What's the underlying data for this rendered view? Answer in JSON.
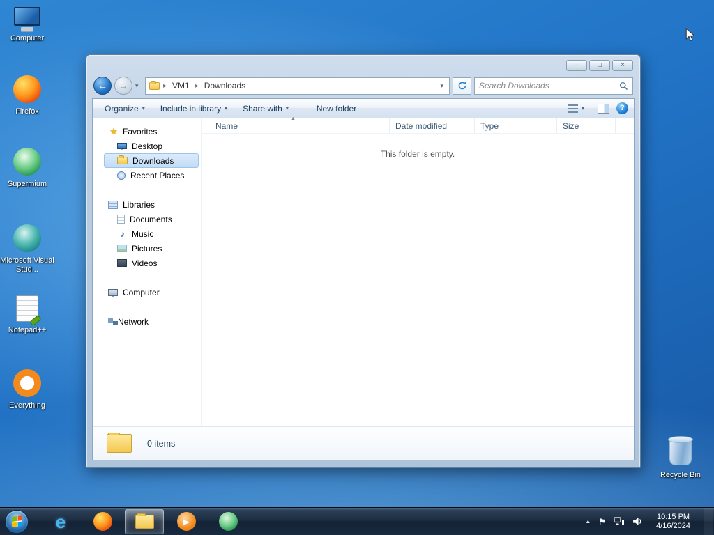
{
  "icons": {
    "back_arrow": "←",
    "forward_arrow": "→",
    "caret_down": "▾",
    "breadcrumb_sep": "▸",
    "sort_asc": "▲",
    "minimize": "–",
    "maximize": "□",
    "close": "×",
    "star": "★",
    "music_note": "♪",
    "help": "?",
    "tray_chevron": "▲",
    "tray_flag": "⚑",
    "play": "▶",
    "ie_letter": "e"
  },
  "desktop": {
    "icons": [
      {
        "label": "Computer"
      },
      {
        "label": "Firefox"
      },
      {
        "label": "Supermium"
      },
      {
        "label": "Microsoft Visual Stud..."
      },
      {
        "label": "Notepad++"
      },
      {
        "label": "Everything"
      }
    ],
    "recycle_bin_label": "Recycle Bin"
  },
  "explorer": {
    "nav": {
      "breadcrumb_root": "VM1",
      "breadcrumb_current": "Downloads",
      "search_placeholder": "Search Downloads"
    },
    "toolbar": {
      "organize": "Organize",
      "include_in_library": "Include in library",
      "share_with": "Share with",
      "new_folder": "New folder"
    },
    "sidebar": {
      "favorites": {
        "label": "Favorites",
        "items": [
          {
            "label": "Desktop"
          },
          {
            "label": "Downloads"
          },
          {
            "label": "Recent Places"
          }
        ]
      },
      "libraries": {
        "label": "Libraries",
        "items": [
          {
            "label": "Documents"
          },
          {
            "label": "Music"
          },
          {
            "label": "Pictures"
          },
          {
            "label": "Videos"
          }
        ]
      },
      "computer": {
        "label": "Computer"
      },
      "network": {
        "label": "Network"
      }
    },
    "columns": [
      {
        "label": "Name"
      },
      {
        "label": "Date modified"
      },
      {
        "label": "Type"
      },
      {
        "label": "Size"
      }
    ],
    "empty_message": "This folder is empty.",
    "status": {
      "items_count": "0 items"
    }
  },
  "taskbar": {
    "clock": {
      "time": "10:15 PM",
      "date": "4/16/2024"
    }
  },
  "colors": {
    "selection_fill": "#cbe3f7",
    "selection_border": "#9cc6e8",
    "desktop_base": "#2173c6",
    "taskbar_base": "#1d2e42"
  }
}
